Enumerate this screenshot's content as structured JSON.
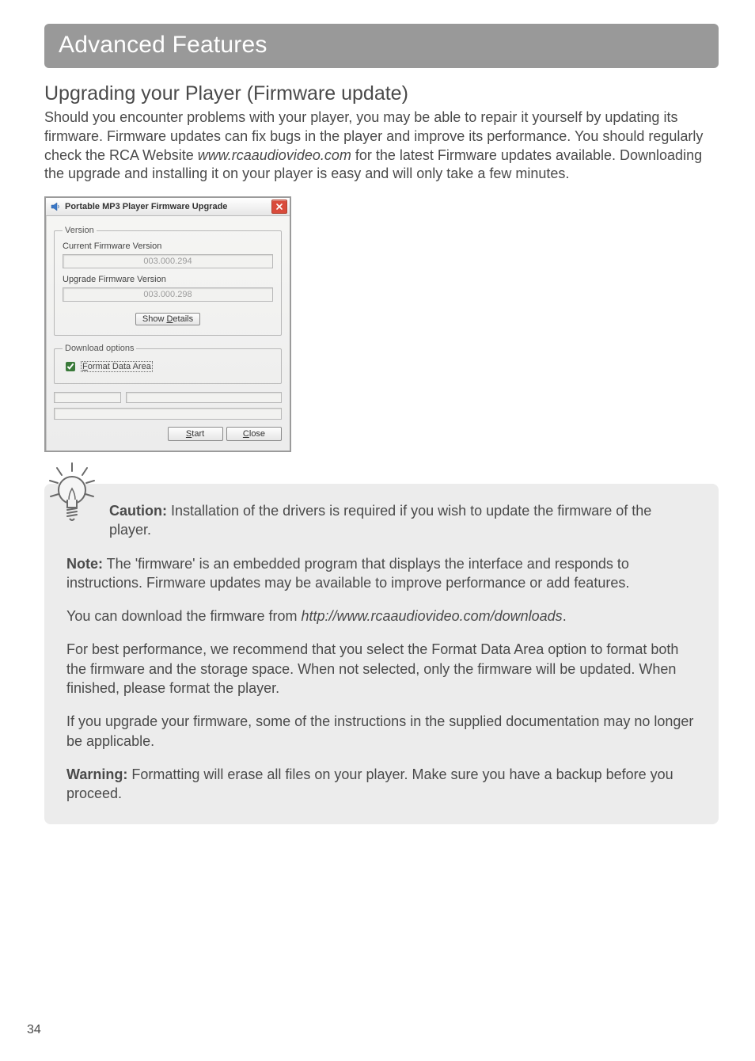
{
  "page_number": "34",
  "banner_title": "Advanced Features",
  "section_heading": "Upgrading your Player (Firmware update)",
  "intro": {
    "pre": "Should you encounter problems with your player, you may be able to repair it yourself by updating its firmware. Firmware updates can fix bugs in the player and improve its performance. You should regularly check the RCA Website ",
    "italic": "www.rcaaudiovideo.com",
    "post": " for the latest Firmware updates available. Downloading the upgrade and installing it on your player is easy and will only take a few minutes."
  },
  "dialog": {
    "title": "Portable MP3 Player Firmware Upgrade",
    "version_group_label": "Version",
    "current_label": "Current Firmware Version",
    "current_value": "003.000.294",
    "upgrade_label": "Upgrade Firmware Version",
    "upgrade_value": "003.000.298",
    "show_details_btn": {
      "prefix": "Show ",
      "u": "D",
      "suffix": "etails"
    },
    "download_group_label": "Download options",
    "format_chk": {
      "u": "F",
      "suffix": "ormat Data Area"
    },
    "start_btn": {
      "u": "S",
      "suffix": "tart"
    },
    "close_btn": {
      "u": "C",
      "suffix": "lose"
    }
  },
  "notices": {
    "caution_label": "Caution:",
    "caution_text": " Installation of the drivers is required if you wish to update the firmware of the player.",
    "note_label": "Note:",
    "note_text": " The 'firmware' is an embedded program that displays the interface and responds to instructions. Firmware updates may be available to improve performance or add features.",
    "download_pre": "You can download the firmware from ",
    "download_url": "http://www.rcaaudiovideo.com/downloads",
    "download_post": ".",
    "best_perf": "For best performance, we recommend that you select the Format Data Area option to format both the firmware and the storage space. When not selected, only the firmware will be updated. When finished, please format the player.",
    "upgrade_note": "If you upgrade your firmware, some of the instructions in the supplied documentation may no longer be applicable.",
    "warning_label": "Warning:",
    "warning_text": " Formatting will erase all files on your player. Make sure you have a backup before you proceed."
  }
}
